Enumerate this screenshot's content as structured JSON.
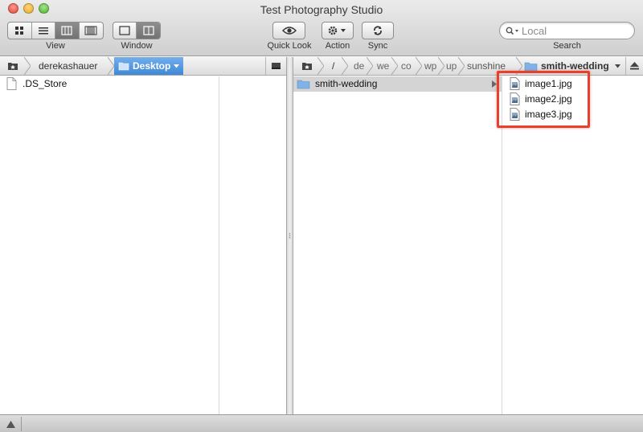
{
  "window": {
    "title": "Test Photography Studio"
  },
  "toolbar": {
    "view_label": "View",
    "window_label": "Window",
    "quicklook_label": "Quick Look",
    "action_label": "Action",
    "sync_label": "Sync",
    "search_label": "Search",
    "search_placeholder": "Local"
  },
  "left_pane": {
    "path": [
      "derekashauer",
      "Desktop"
    ],
    "items": [
      {
        "name": ".DS_Store",
        "icon": "document-icon"
      }
    ]
  },
  "right_pane": {
    "path": [
      "/",
      "de",
      "we",
      "co",
      "wp",
      "up",
      "sunshine",
      "smith-wedding"
    ],
    "column1": [
      {
        "name": "smith-wedding",
        "icon": "folder-icon",
        "selected": true
      }
    ],
    "column2": [
      {
        "name": "image1.jpg",
        "icon": "image-file-icon"
      },
      {
        "name": "image2.jpg",
        "icon": "image-file-icon"
      },
      {
        "name": "image3.jpg",
        "icon": "image-file-icon"
      }
    ]
  },
  "colors": {
    "accent_blue": "#3f88d6",
    "highlight_red": "#e8402a",
    "folder_blue": "#7fb3e6"
  }
}
